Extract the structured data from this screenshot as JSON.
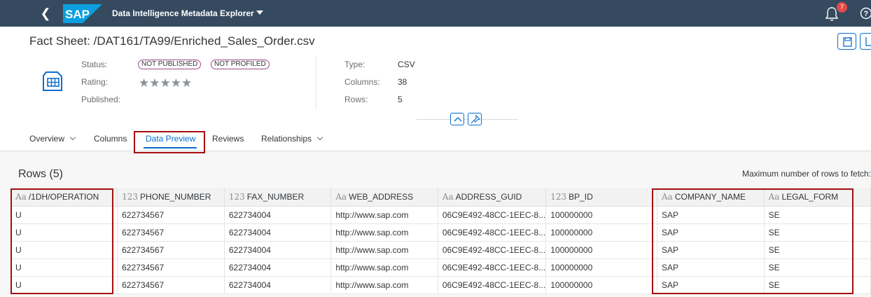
{
  "shell": {
    "logo_text": "SAP",
    "app_title": "Data Intelligence Metadata Explorer",
    "notification_count": "7"
  },
  "header": {
    "title": "Fact Sheet: /DAT161/TA99/Enriched_Sales_Order.csv",
    "status_label": "Status:",
    "status_tags": [
      "NOT PUBLISHED",
      "NOT PROFILED"
    ],
    "rating_label": "Rating:",
    "rating_stars": "★★★★★",
    "rating_value": 0,
    "published_label": "Published:",
    "type_label": "Type:",
    "type_value": "CSV",
    "columns_label": "Columns:",
    "columns_value": "38",
    "rows_label": "Rows:",
    "rows_value": "5"
  },
  "tabs": [
    {
      "label": "Overview"
    },
    {
      "label": "Columns"
    },
    {
      "label": "Data Preview"
    },
    {
      "label": "Reviews"
    },
    {
      "label": "Relationships"
    }
  ],
  "preview": {
    "rows_title": "Rows (5)",
    "max_rows_label": "Maximum number of rows to fetch:",
    "columns": [
      {
        "type_icon": "Aa",
        "name": "/1DH/OPERATION"
      },
      {
        "type_icon": "123",
        "name": "PHONE_NUMBER"
      },
      {
        "type_icon": "123",
        "name": "FAX_NUMBER"
      },
      {
        "type_icon": "Aa",
        "name": "WEB_ADDRESS"
      },
      {
        "type_icon": "Aa",
        "name": "ADDRESS_GUID"
      },
      {
        "type_icon": "123",
        "name": "BP_ID"
      },
      {
        "type_icon": "",
        "name": ""
      },
      {
        "type_icon": "Aa",
        "name": "COMPANY_NAME"
      },
      {
        "type_icon": "Aa",
        "name": "LEGAL_FORM"
      }
    ],
    "rows": [
      [
        "U",
        "622734567",
        "622734004",
        "http://www.sap.com",
        "06C9E492-48CC-1EEC-8...",
        "100000000",
        "",
        "SAP",
        "SE"
      ],
      [
        "U",
        "622734567",
        "622734004",
        "http://www.sap.com",
        "06C9E492-48CC-1EEC-8...",
        "100000000",
        "",
        "SAP",
        "SE"
      ],
      [
        "U",
        "622734567",
        "622734004",
        "http://www.sap.com",
        "06C9E492-48CC-1EEC-8...",
        "100000000",
        "",
        "SAP",
        "SE"
      ],
      [
        "U",
        "622734567",
        "622734004",
        "http://www.sap.com",
        "06C9E492-48CC-1EEC-8...",
        "100000000",
        "",
        "SAP",
        "SE"
      ],
      [
        "U",
        "622734567",
        "622734004",
        "http://www.sap.com",
        "06C9E492-48CC-1EEC-8...",
        "100000000",
        "",
        "SAP",
        "SE"
      ]
    ]
  },
  "colors": {
    "shell_bg": "#354a5f",
    "accent": "#0a6ed1",
    "tag_border": "#a2498c",
    "highlight": "#a50e0e",
    "badge": "#e44b4b"
  },
  "icons": [
    "back-icon",
    "sap-logo",
    "bell-icon",
    "help-icon",
    "dataset-icon",
    "save-icon",
    "download-icon",
    "collapse-icon",
    "pin-icon"
  ]
}
